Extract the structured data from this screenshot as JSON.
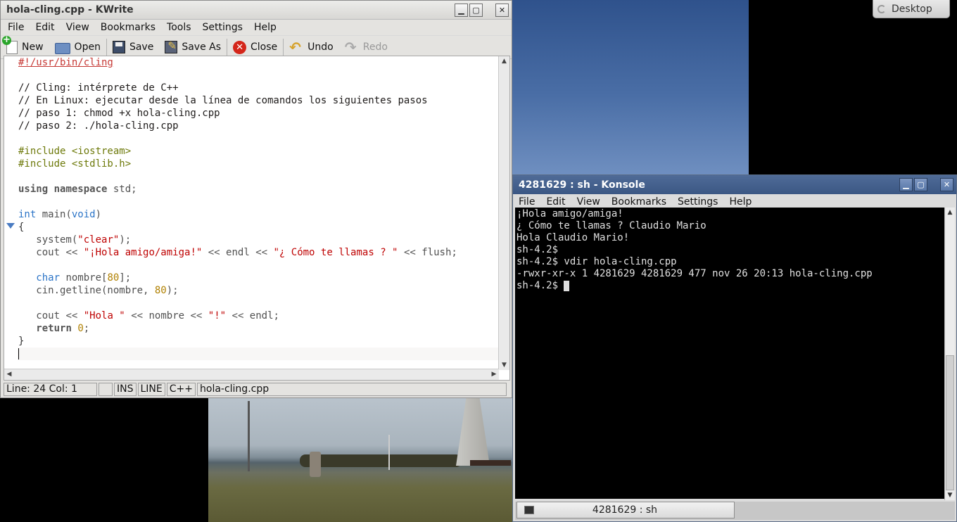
{
  "desktop": {
    "pager_label": "Desktop"
  },
  "kwrite": {
    "title": "hola-cling.cpp - KWrite",
    "menu": [
      "File",
      "Edit",
      "View",
      "Bookmarks",
      "Tools",
      "Settings",
      "Help"
    ],
    "toolbar": {
      "new": "New",
      "open": "Open",
      "save": "Save",
      "save_as": "Save As",
      "close": "Close",
      "undo": "Undo",
      "redo": "Redo"
    },
    "code": [
      "#!/usr/bin/cling",
      "",
      "// Cling: intérprete de C++",
      "// En Linux: ejecutar desde la línea de comandos los siguientes pasos",
      "// paso 1: chmod +x hola-cling.cpp",
      "// paso 2: ./hola-cling.cpp",
      "",
      "#include <iostream>",
      "#include <stdlib.h>",
      "",
      "using namespace std;",
      "",
      "int main(void)",
      "{",
      "   system(\"clear\");",
      "   cout << \"¡Hola amigo/amiga!\" << endl << \"¿ Cómo te llamas ? \" << flush;",
      "",
      "   char nombre[80];",
      "   cin.getline(nombre, 80);",
      "",
      "   cout << \"Hola \" << nombre << \"!\" << endl;",
      "   return 0;",
      "}",
      ""
    ],
    "status": {
      "position": "Line: 24 Col: 1",
      "modified": "",
      "mode": "INS",
      "selection": "LINE",
      "syntax": "C++",
      "filename": "hola-cling.cpp"
    }
  },
  "konsole": {
    "title": "4281629 : sh - Konsole",
    "menu": [
      "File",
      "Edit",
      "View",
      "Bookmarks",
      "Settings",
      "Help"
    ],
    "terminal_lines": [
      "¡Hola amigo/amiga!",
      "¿ Cómo te llamas ? Claudio Mario",
      "Hola Claudio Mario!",
      "sh-4.2$",
      "sh-4.2$ vdir hola-cling.cpp",
      "-rwxr-xr-x 1 4281629 4281629 477 nov 26 20:13 hola-cling.cpp"
    ],
    "prompt": "sh-4.2$ ",
    "tab_label": "4281629 : sh"
  }
}
